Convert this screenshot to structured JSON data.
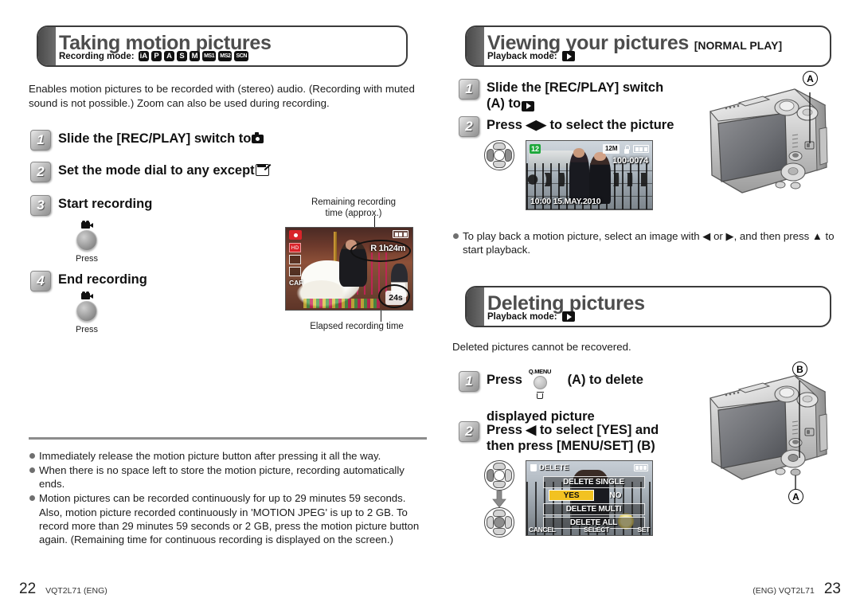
{
  "left": {
    "header": {
      "title": "Taking motion pictures",
      "mode_label": "Recording mode:",
      "modes": [
        "iA",
        "P",
        "A",
        "S",
        "M",
        "MS1",
        "MS2",
        "SCN"
      ]
    },
    "intro": "Enables motion pictures to be recorded with (stereo) audio. (Recording with muted sound is not possible.) Zoom can also be used during recording.",
    "steps": [
      {
        "num": "1",
        "text": "Slide the [REC/PLAY] switch to"
      },
      {
        "num": "2",
        "text": "Set the mode dial to any except"
      },
      {
        "num": "3",
        "text": "Start recording"
      },
      {
        "num": "4",
        "text": "End recording"
      }
    ],
    "press_caption_1": "Press",
    "press_caption_2": "Press",
    "lcd": {
      "remaining_label": "Remaining recording\ntime (approx.)",
      "remaining_label_line1": "Remaining recording",
      "remaining_label_line2": "time (approx.)",
      "remaining_value": "R 1h24m",
      "elapsed_label": "Elapsed recording time",
      "elapsed_value": "24s",
      "osd_hd": "HD",
      "osd_caf": "CAF"
    },
    "notes": [
      "Immediately release the motion picture button after pressing it all the way.",
      "When there is no space left to store the motion picture, recording automatically ends.",
      "Motion pictures can be recorded continuously for up to 29 minutes 59 seconds. Also, motion picture recorded continuously in 'MOTION JPEG' is up to 2 GB. To record more than 29 minutes 59 seconds or 2 GB, press the motion picture button again. (Remaining time for continuous recording is displayed on the screen.)"
    ],
    "footer": {
      "page": "22",
      "code": "VQT2L71 (ENG)"
    }
  },
  "right": {
    "viewing": {
      "header": {
        "title": "Viewing your pictures",
        "suffix": "[NORMAL PLAY]",
        "mode_label": "Playback mode:",
        "mode_icon": "play-icon"
      },
      "steps": [
        {
          "num": "1",
          "line1": "Slide the [REC/PLAY] switch",
          "line2": "(A) to"
        },
        {
          "num": "2",
          "text": "Press ◀▶ to select the picture"
        }
      ],
      "lcd": {
        "index": "12",
        "resolution": "12M",
        "file_number": "100-0074",
        "datetime": "10:00  15.MAY.2010"
      },
      "note": "To play back a motion picture, select an image with ◀ or ▶, and then press ▲ to start playback.",
      "callout": "A"
    },
    "deleting": {
      "header": {
        "title": "Deleting pictures",
        "mode_label": "Playback mode:",
        "mode_icon": "play-icon"
      },
      "intro": "Deleted pictures cannot be recovered.",
      "steps": [
        {
          "num": "1",
          "line1": "Press",
          "qmenu": "Q.MENU",
          "line1b": "(A) to delete",
          "line2": "displayed picture"
        },
        {
          "num": "2",
          "line1": "Press ◀ to select [YES] and",
          "line2": "then press [MENU/SET] (B)"
        }
      ],
      "menu": {
        "title": "DELETE",
        "row_single": "DELETE SINGLE",
        "yes": "YES",
        "no": "NO",
        "row_multi": "DELETE MULTI",
        "row_all": "DELETE ALL",
        "footer_left": "CANCEL",
        "footer_mid": "SELECT",
        "footer_right": "SET"
      },
      "callout_b": "B",
      "callout_a": "A"
    },
    "footer": {
      "code": "(ENG) VQT2L71",
      "page": "23"
    }
  },
  "colors": {
    "banner_tab": "#4a4a4a",
    "banner_title": "#4d4d4d",
    "rule": "#8c8c8c",
    "bullet": "#6f6f6f",
    "rec_red": "#d9242a",
    "menu_yellow": "#f2c221",
    "index_green": "#1fa83c"
  }
}
